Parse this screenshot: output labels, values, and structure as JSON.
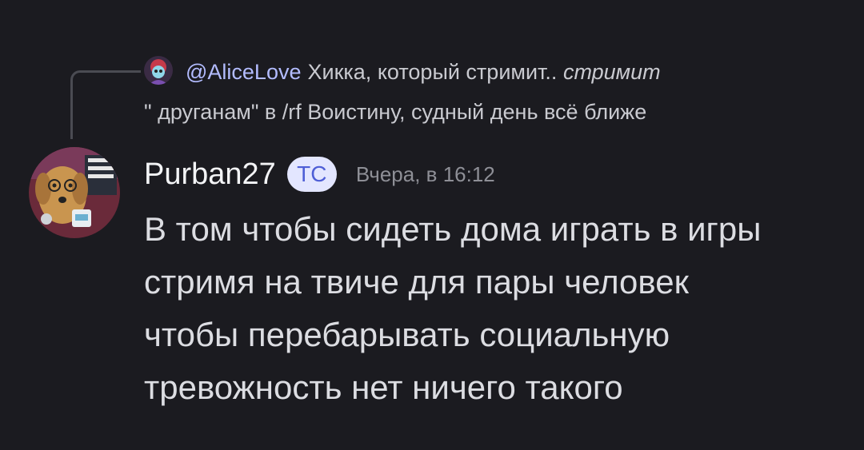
{
  "reply": {
    "mention": "@AliceLove",
    "text_part1": "Хикка, который стримит.. ",
    "text_italic": "стримит",
    "text_line2": "\" друганам\" в /rf  Воистину, судный день всё ближе"
  },
  "message": {
    "username": "Purban27",
    "badge": "ТС",
    "timestamp": "Вчера, в 16:12",
    "lines": [
      "В том чтобы сидеть дома играть в игры",
      "стримя на твиче для пары человек",
      "чтобы перебарывать социальную",
      "тревожность нет ничего такого"
    ]
  },
  "colors": {
    "background": "#1b1b20",
    "mention": "#b3bcff",
    "badge_bg": "#e3e6ff",
    "badge_text": "#4e5ed6"
  },
  "icons": {
    "reply_avatar": "anime-character-avatar-icon",
    "user_avatar": "dog-avatar-icon"
  }
}
